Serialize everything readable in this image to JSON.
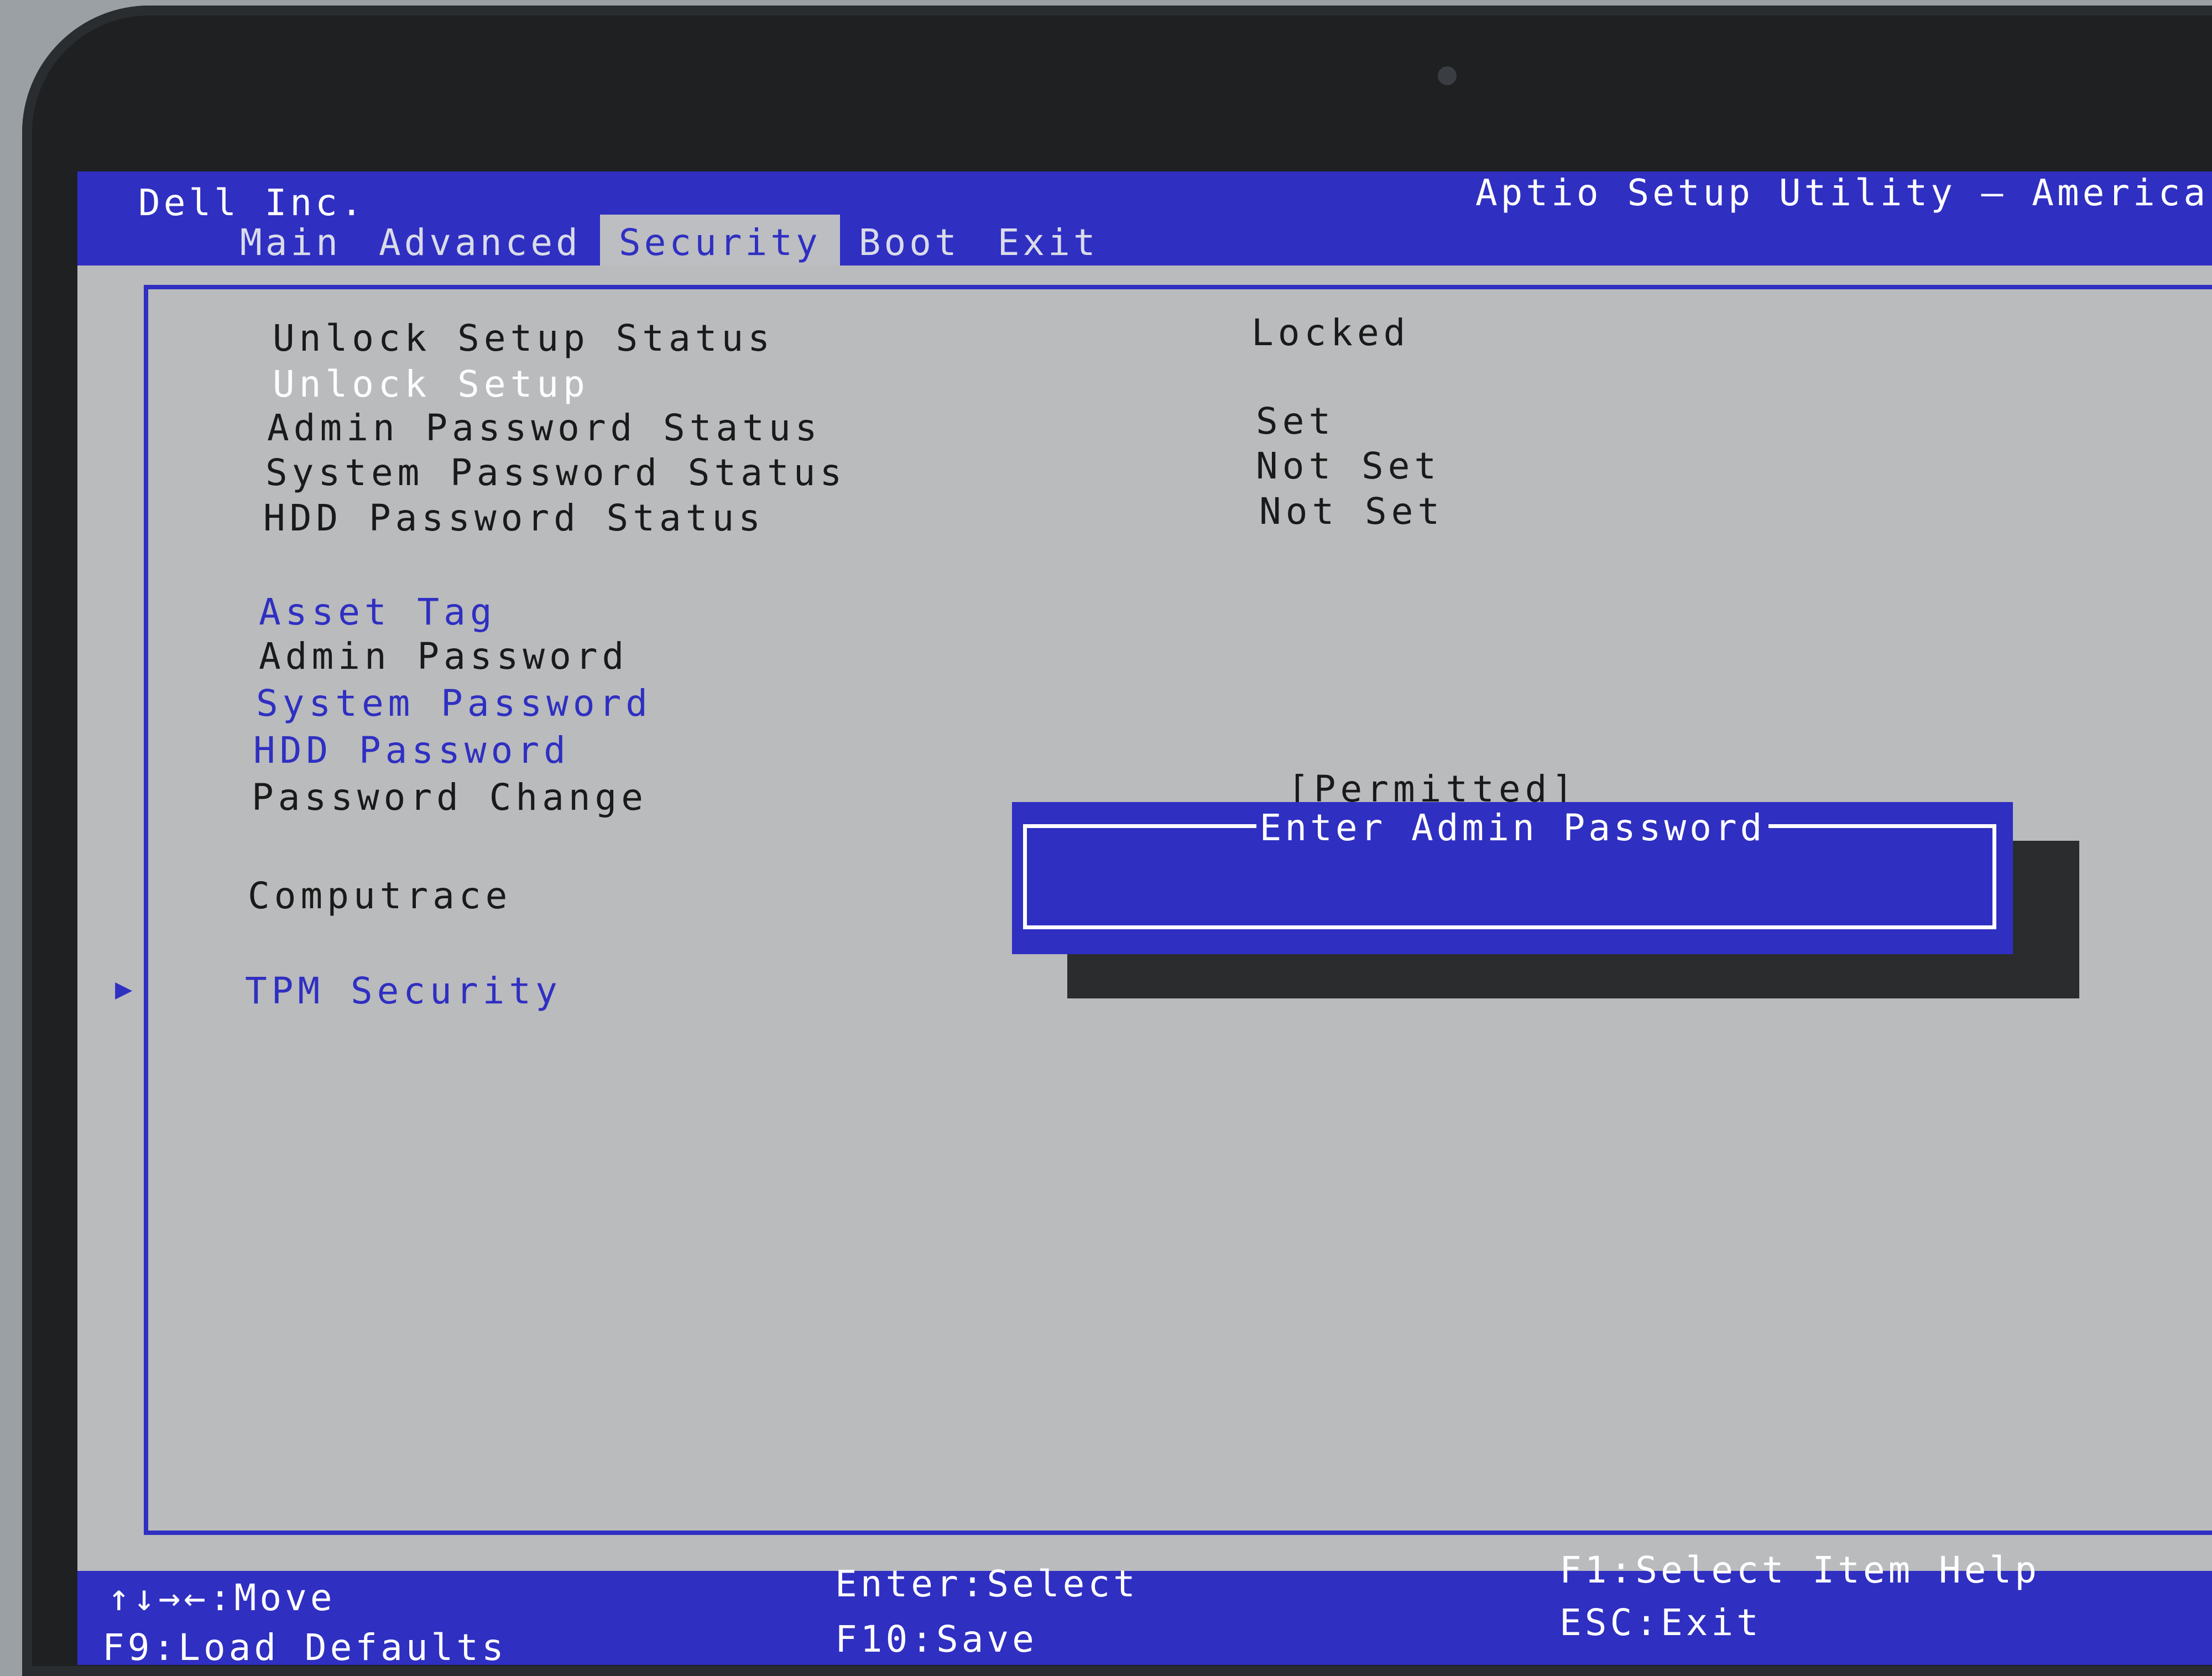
{
  "header": {
    "vendor": "Dell Inc.",
    "utility_title": "Aptio Setup Utility – American",
    "tabs": [
      {
        "label": "Main"
      },
      {
        "label": "Advanced"
      },
      {
        "label": "Security",
        "active": true
      },
      {
        "label": "Boot"
      },
      {
        "label": "Exit"
      }
    ]
  },
  "security": {
    "items": [
      {
        "label": "Unlock Setup Status",
        "value": "Locked"
      },
      {
        "label": "Unlock Setup"
      },
      {
        "label": "Admin Password Status",
        "value": "Set"
      },
      {
        "label": "System Password Status",
        "value": "Not Set"
      },
      {
        "label": "HDD Password Status",
        "value": "Not Set"
      },
      {
        "label": "Asset Tag"
      },
      {
        "label": "Admin Password"
      },
      {
        "label": "System Password"
      },
      {
        "label": "HDD Password"
      },
      {
        "label": "Password Change",
        "value": "[Permitted]"
      },
      {
        "label": "Computrace"
      },
      {
        "label": "TPM Security",
        "submenu": true
      }
    ]
  },
  "dialog": {
    "title": "Enter Admin Password",
    "input_value": ""
  },
  "footer": {
    "move": "↑↓→←:Move",
    "load_defaults": "F9:Load Defaults",
    "select": "Enter:Select",
    "save": "F10:Save",
    "help": "F1:Select Item Help",
    "exit": "ESC:Exit"
  },
  "colors": {
    "accent_blue": "#2f2fc2",
    "panel_gray": "#b9bbbd",
    "text_white": "#ffffff"
  },
  "icons": {
    "submenu_arrow": "submenu-arrow-icon"
  }
}
